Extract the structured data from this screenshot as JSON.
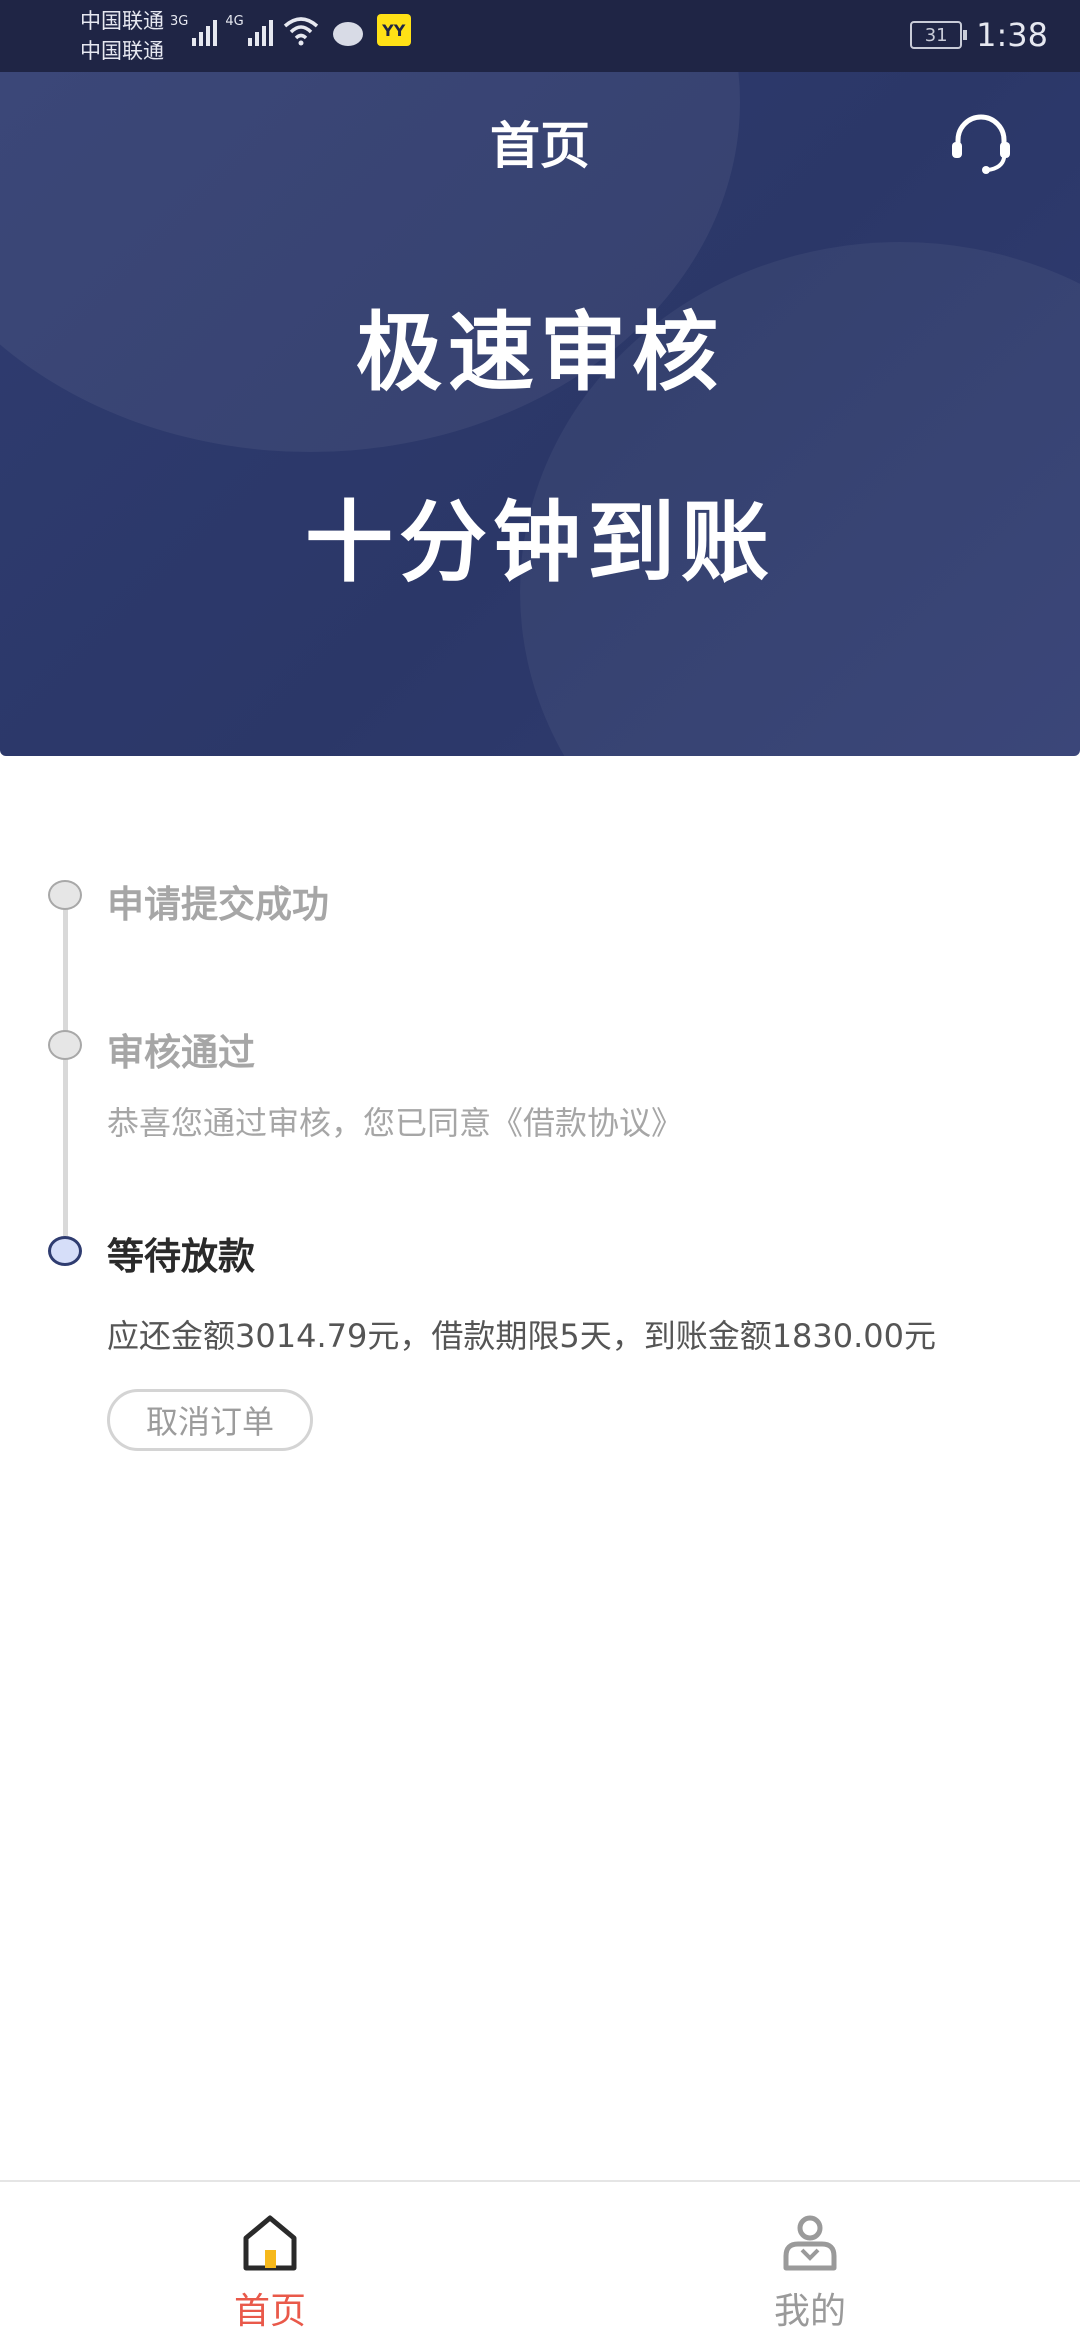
{
  "status_bar": {
    "carrier1": "中国联通",
    "carrier2": "中国联通",
    "net1": "3G",
    "net2": "4G",
    "app_badge": "YY",
    "battery": "31",
    "time": "1:38"
  },
  "header": {
    "title": "首页",
    "service_icon": "headset-icon"
  },
  "hero": {
    "line1": "极速审核",
    "line2": "十分钟到账"
  },
  "timeline": {
    "steps": [
      {
        "title": "申请提交成功",
        "desc": "",
        "state": "done"
      },
      {
        "title": "审核通过",
        "desc": "恭喜您通过审核，您已同意《借款协议》",
        "state": "done"
      },
      {
        "title": "等待放款",
        "desc": "应还金额3014.79元，借款期限5天，到账金额1830.00元",
        "state": "current"
      }
    ],
    "cancel_label": "取消订单"
  },
  "tabbar": {
    "home_label": "首页",
    "mine_label": "我的",
    "active_color": "#e9594a",
    "inactive_color": "#9a9a9a"
  },
  "colors": {
    "hero_bg": "#2f3c70",
    "accent": "#e9594a"
  }
}
